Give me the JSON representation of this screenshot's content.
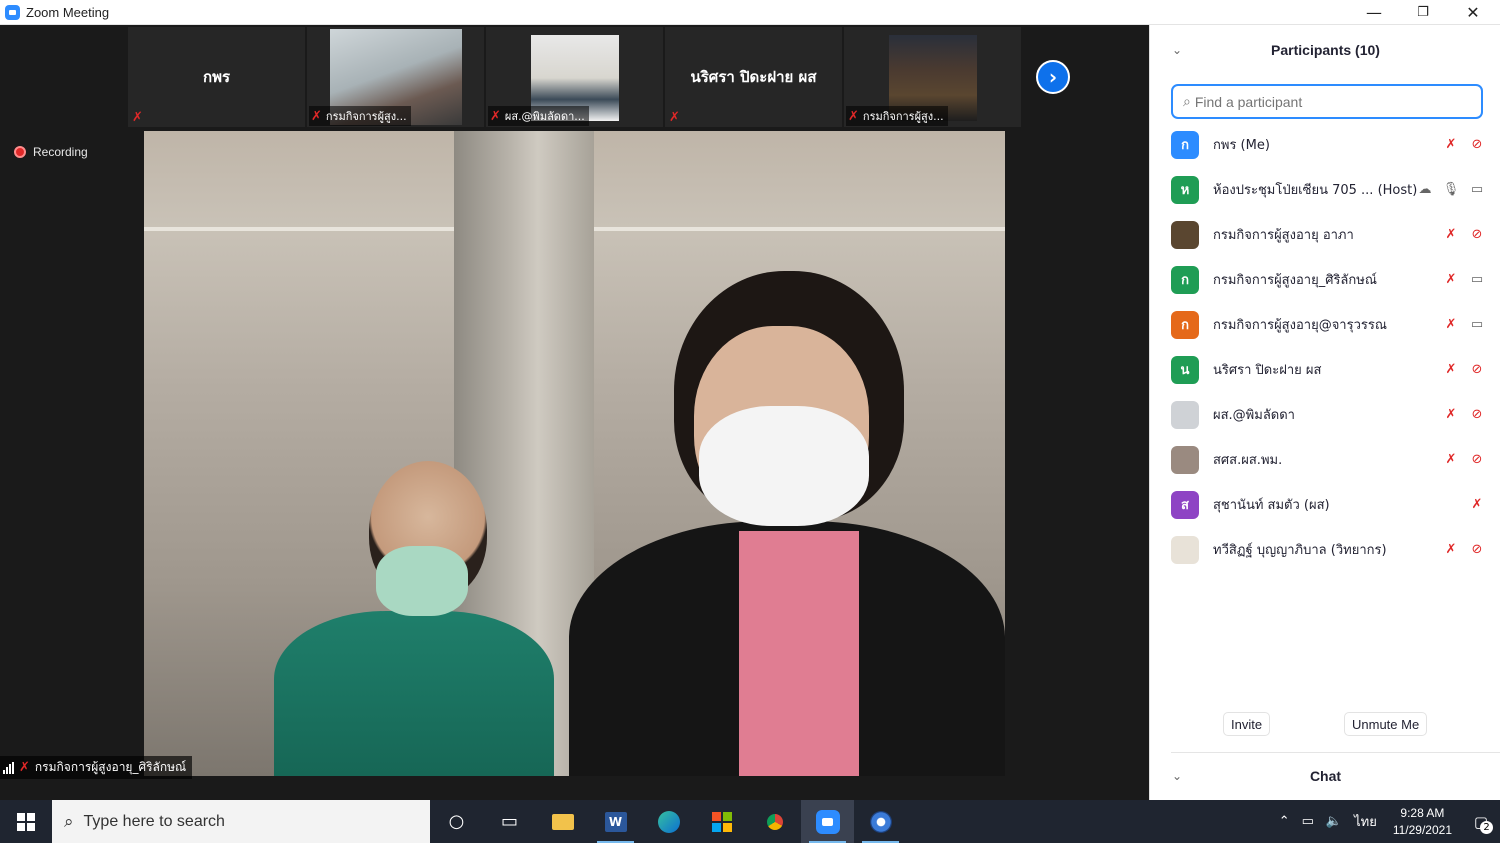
{
  "window": {
    "title": "Zoom Meeting",
    "minimize": "—",
    "restore": "❐",
    "close": "✕"
  },
  "meeting": {
    "thumbnails": [
      {
        "name": "กพร",
        "type": "name",
        "label": ""
      },
      {
        "name": "",
        "type": "video",
        "label": "กรมกิจการผู้สูง..."
      },
      {
        "name": "",
        "type": "video",
        "label": "ผส.@พิมลัดดา..."
      },
      {
        "name": "นริศรา ปิดะฝาย ผส",
        "type": "name",
        "label": ""
      },
      {
        "name": "",
        "type": "video",
        "label": "กรมกิจการผู้สูง..."
      }
    ],
    "next_arrow": "›",
    "recording_label": "Recording",
    "active_speaker_label": "กรมกิจการผู้สูงอายุ_ศิริลักษณ์"
  },
  "participants": {
    "title": "Participants (10)",
    "collapse_icon": "⌄",
    "search_placeholder": "Find a participant",
    "list": [
      {
        "initial": "ก",
        "name": "กพร (Me)",
        "color": "#2d8cff",
        "mic": "off",
        "cam": "off",
        "photo": false
      },
      {
        "initial": "ห",
        "name": "ห้องประชุมโป่ยเซียน 705 ...  (Host)",
        "color": "#1f9d55",
        "mic": "on",
        "cam": "on",
        "photo": false,
        "cloud": true
      },
      {
        "initial": "",
        "name": "กรมกิจการผู้สูงอายุ อาภา",
        "color": "#5a4630",
        "mic": "off",
        "cam": "off",
        "photo": true
      },
      {
        "initial": "ก",
        "name": "กรมกิจการผู้สูงอายุ_ศิริลักษณ์",
        "color": "#1f9d55",
        "mic": "off",
        "cam": "on",
        "photo": false
      },
      {
        "initial": "ก",
        "name": "กรมกิจการผู้สูงอายุ@จารุวรรณ",
        "color": "#e5691a",
        "mic": "off",
        "cam": "on",
        "photo": false
      },
      {
        "initial": "น",
        "name": "นริศรา ปิดะฝาย ผส",
        "color": "#1f9d55",
        "mic": "off",
        "cam": "off",
        "photo": false
      },
      {
        "initial": "",
        "name": "ผส.@พิมลัดดา",
        "color": "#cfd2d6",
        "mic": "off",
        "cam": "off",
        "photo": true
      },
      {
        "initial": "",
        "name": "สศส.ผส.พม.",
        "color": "#9a8a80",
        "mic": "off",
        "cam": "off",
        "photo": true
      },
      {
        "initial": "ส",
        "name": "สุชานันท์ สมตัว (ผส)",
        "color": "#8e44c4",
        "mic": "off",
        "cam": "none",
        "photo": false
      },
      {
        "initial": "",
        "name": "ทวีสิฏฐ์ บุญญาภิบาล (วิทยากร)",
        "color": "#e8e2d8",
        "mic": "off",
        "cam": "off",
        "photo": true
      }
    ],
    "invite_label": "Invite",
    "unmute_label": "Unmute Me",
    "chat_title": "Chat"
  },
  "taskbar": {
    "search_text": "Type here to search",
    "time": "9:28 AM",
    "date": "11/29/2021",
    "lang": "ไทย",
    "notifications": "2"
  }
}
